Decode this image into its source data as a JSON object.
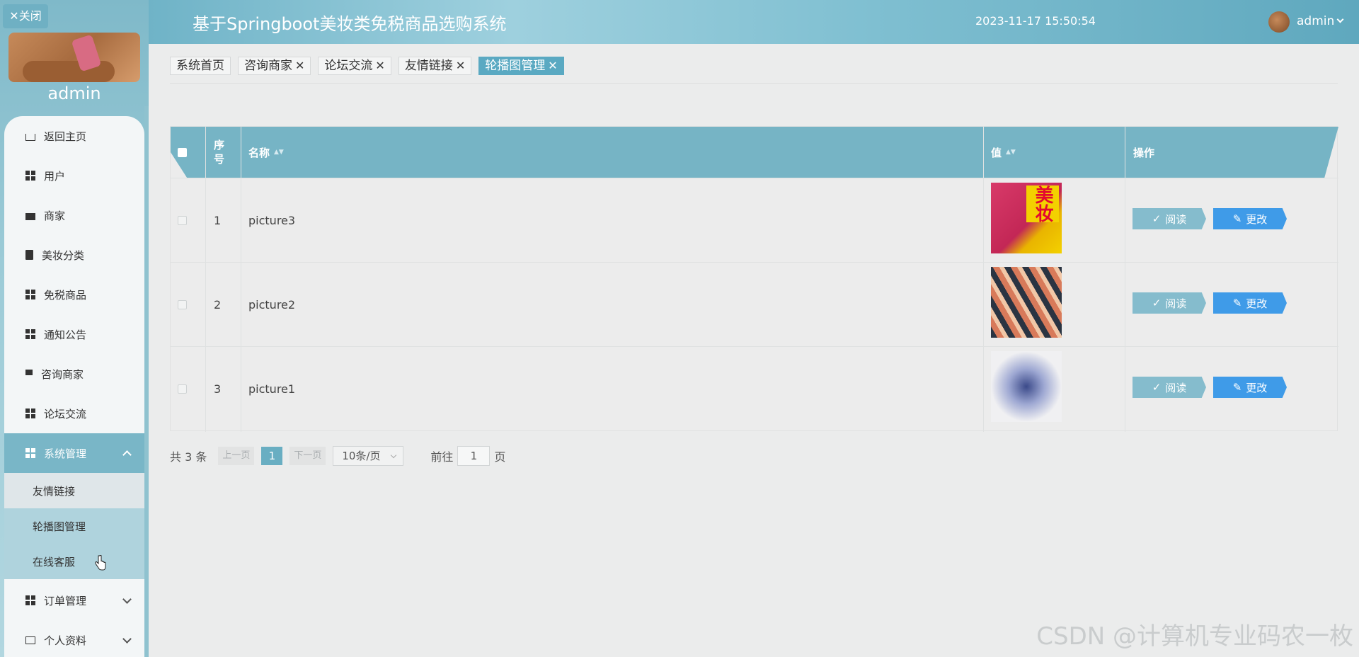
{
  "sidebar": {
    "close_label": "✕关闭",
    "username": "admin",
    "menu": [
      {
        "label": "返回主页",
        "icon": "home-icon"
      },
      {
        "label": "用户",
        "icon": "grid-icon"
      },
      {
        "label": "商家",
        "icon": "store-icon"
      },
      {
        "label": "美妆分类",
        "icon": "clipboard-icon"
      },
      {
        "label": "免税商品",
        "icon": "grid-icon"
      },
      {
        "label": "通知公告",
        "icon": "grid-icon"
      },
      {
        "label": "咨询商家",
        "icon": "pin-icon"
      },
      {
        "label": "论坛交流",
        "icon": "grid-icon"
      },
      {
        "label": "系统管理",
        "icon": "grid-icon",
        "expanded": true
      },
      {
        "label": "订单管理",
        "icon": "grid-icon"
      },
      {
        "label": "个人资料",
        "icon": "card-icon"
      }
    ],
    "submenu": [
      "友情链接",
      "轮播图管理",
      "在线客服"
    ]
  },
  "header": {
    "title": "基于Springboot美妆类免税商品选购系统",
    "datetime": "2023-11-17 15:50:54",
    "user": "admin"
  },
  "tabs": [
    {
      "label": "系统首页",
      "closable": false
    },
    {
      "label": "咨询商家",
      "closable": true
    },
    {
      "label": "论坛交流",
      "closable": true
    },
    {
      "label": "友情链接",
      "closable": true
    },
    {
      "label": "轮播图管理",
      "closable": true,
      "active": true
    }
  ],
  "table": {
    "columns": {
      "index": "序\n号",
      "name": "名称",
      "value": "值",
      "actions": "操作"
    },
    "rows": [
      {
        "index": "1",
        "name": "picture3",
        "thumb_text": "美妆"
      },
      {
        "index": "2",
        "name": "picture2"
      },
      {
        "index": "3",
        "name": "picture1"
      }
    ],
    "read_label": "阅读",
    "edit_label": "更改"
  },
  "pager": {
    "total": "共 3 条",
    "prev": "上一页",
    "page": "1",
    "next": "下一页",
    "size": "10条/页",
    "goto_prefix": "前往",
    "goto_value": "1",
    "goto_suffix": "页"
  },
  "watermark": "CSDN @计算机专业码农一枚",
  "colors": {
    "accent": "#76b4c5",
    "edit": "#3f9be8",
    "read": "#85bccd"
  }
}
